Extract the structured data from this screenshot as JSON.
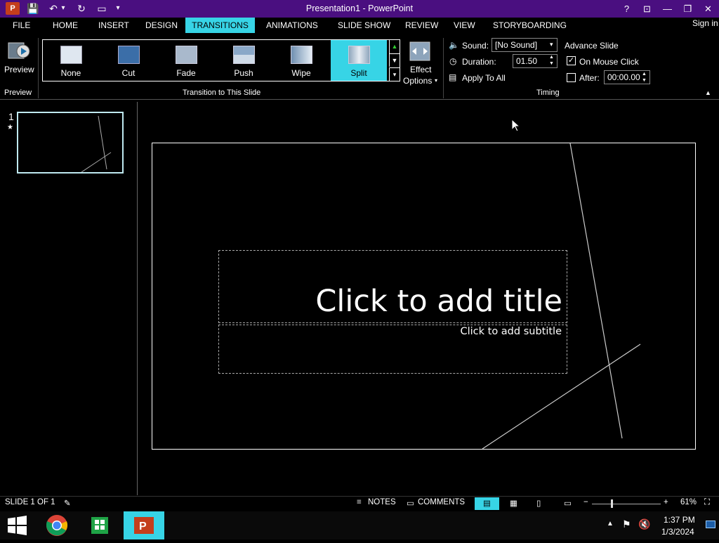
{
  "window": {
    "title": "Presentation1 - PowerPoint",
    "app_icon_label": "P",
    "controls": {
      "help": "?",
      "restore_ribbon": "⊡",
      "minimize": "—",
      "maximize": "❐",
      "close": "✕"
    }
  },
  "quick_access": {
    "save": "💾",
    "undo": "↶",
    "undo_dropdown": "▾",
    "redo": "↻",
    "start": "▭",
    "customize": "▾"
  },
  "tabs": [
    "FILE",
    "HOME",
    "INSERT",
    "DESIGN",
    "TRANSITIONS",
    "ANIMATIONS",
    "SLIDE SHOW",
    "REVIEW",
    "VIEW",
    "STORYBOARDING"
  ],
  "active_tab": "TRANSITIONS",
  "signin": "Sign in",
  "ribbon": {
    "preview": {
      "label": "Preview",
      "group": "Preview"
    },
    "gallery": {
      "group": "Transition to This Slide",
      "items": [
        {
          "label": "None"
        },
        {
          "label": "Cut"
        },
        {
          "label": "Fade"
        },
        {
          "label": "Push"
        },
        {
          "label": "Wipe"
        },
        {
          "label": "Split"
        }
      ],
      "selected": "Split"
    },
    "effect_options": {
      "line1": "Effect",
      "line2": "Options"
    },
    "timing": {
      "group": "Timing",
      "sound_label": "Sound:",
      "sound_value": "[No Sound]",
      "duration_label": "Duration:",
      "duration_value": "01.50",
      "apply_all": "Apply To All",
      "advance_title": "Advance Slide",
      "on_mouse_click": "On Mouse Click",
      "on_mouse_click_checked": true,
      "after_label": "After:",
      "after_checked": false,
      "after_value": "00:00.00"
    }
  },
  "slides_pane": {
    "number": "1",
    "star": "★"
  },
  "slide": {
    "title_placeholder": "Click to add title",
    "subtitle_placeholder": "Click to add subtitle"
  },
  "statusbar": {
    "slide_info": "SLIDE 1 OF 1",
    "notes": "NOTES",
    "comments": "COMMENTS",
    "zoom": "61%",
    "zoom_minus": "−",
    "zoom_plus": "+"
  },
  "taskbar": {
    "time": "1:37 PM",
    "date": "1/3/2024"
  },
  "colors": {
    "accent": "#37d4e6",
    "titlebar": "#4a0f80"
  }
}
